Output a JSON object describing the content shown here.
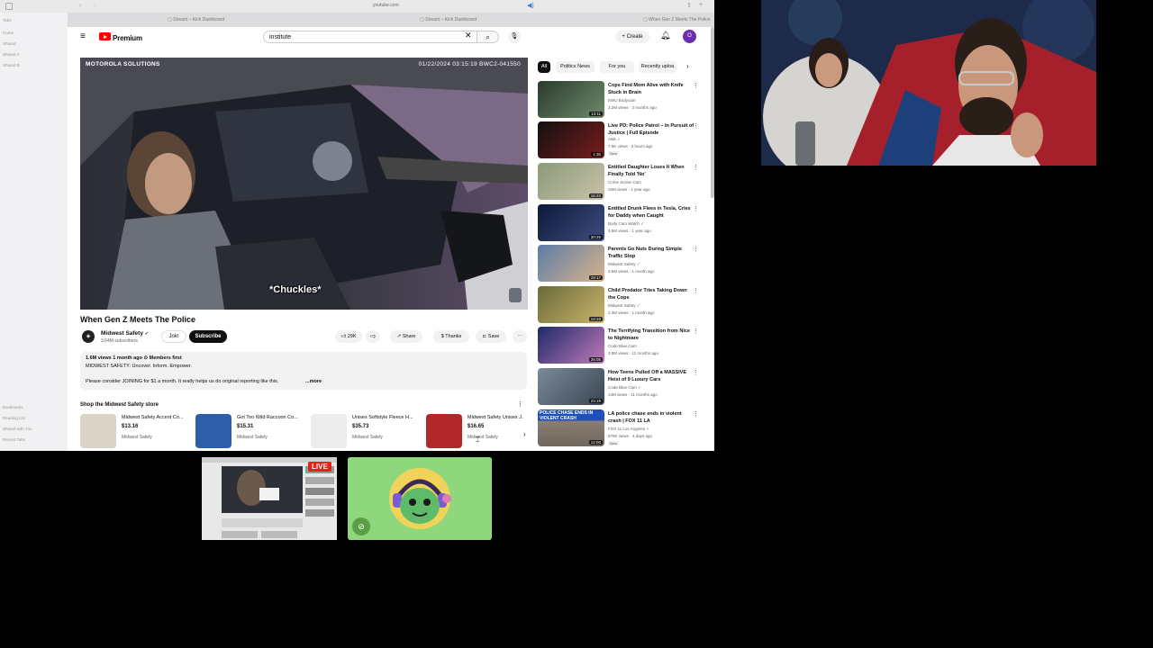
{
  "browser": {
    "url": "youtube.com",
    "tabs": [
      "Stream – Kick Dashboard",
      "Stream – Kick Dashboard",
      "When Gen Z Meets The Police"
    ],
    "sidebar_items": [
      "Tabs",
      "Home",
      "Shared",
      "Shared A",
      "Shared B",
      "Bookmarks",
      "Reading List",
      "Shared with You",
      "Recent Tabs"
    ]
  },
  "youtube": {
    "logo": "Premium",
    "search_value": "institute",
    "create_label": "Create",
    "avatar_letter": "O",
    "video": {
      "brand_overlay": "MOTOROLA SOLUTIONS",
      "timestamp_overlay": "01/22/2024 03:15:19  BWC2-041550",
      "caption": "*Chuckles*",
      "title": "When Gen Z Meets The Police"
    },
    "channel": {
      "name": "Midwest Safety",
      "subs": "3.64M subscribers",
      "join_label": "Join",
      "subscribe_label": "Subscribe"
    },
    "actions": {
      "likes": "29K",
      "share": "Share",
      "thanks": "Thanks",
      "save": "Save"
    },
    "description": {
      "stats": "1.6M views  1 month ago  ⊙ Members first",
      "line1": "MIDWEST SAFETY: Uncover. Inform. Empower.",
      "line2": "Please consider JOINING for $1 a month. It really helps us do original reporting like this.",
      "more": "...more"
    },
    "store": {
      "title": "Shop the Midwest Safety store",
      "products": [
        {
          "name": "Midwest Safety Accent Co...",
          "price": "$13.16",
          "store": "Midwest Safety"
        },
        {
          "name": "Got Too Wild Raccoon Co...",
          "price": "$15.31",
          "store": "Midwest Safety"
        },
        {
          "name": "Unisex Softstyle Fleece H...",
          "price": "$35.73",
          "store": "Midwest Safety"
        },
        {
          "name": "Midwest Safety Unisex J...",
          "price": "$16.65",
          "store": "Midwest Safety"
        }
      ]
    },
    "chips": [
      "All",
      "Politics News",
      "For you",
      "Recently uploa"
    ],
    "recommendations": [
      {
        "title": "Cops Find Mom Alive with Knife Stuck in Brain",
        "channel": "EWU Bodycam",
        "meta": "3.2M views · 2 months ago",
        "duration": "13:11",
        "new": ""
      },
      {
        "title": "Live PD: Police Patrol – In Pursuit of Justice | Full Episode",
        "channel": "A&E ✓",
        "meta": "7.5K views · 3 hours ago",
        "duration": "1:36",
        "new": "New"
      },
      {
        "title": "Entitled Daughter Loses It When Finally Told 'No'",
        "channel": "Crime Scene Cam",
        "meta": "10M views · 1 year ago",
        "duration": "16:22",
        "new": ""
      },
      {
        "title": "Entitled Drunk Flees in Tesla, Cries for Daddy when Caught",
        "channel": "Body Cam Watch ✓",
        "meta": "3.5M views · 1 year ago",
        "duration": "20:25",
        "new": ""
      },
      {
        "title": "Parents Go Nuts During Simple Traffic Stop",
        "channel": "Midwest Safety ✓",
        "meta": "3.6M views · 1 month ago",
        "duration": "19:17",
        "new": ""
      },
      {
        "title": "Child Predator Tries Taking Down the Cops",
        "channel": "Midwest Safety ✓",
        "meta": "2.3M views · 1 month ago",
        "duration": "14:10",
        "new": ""
      },
      {
        "title": "The Terrifying Transition from Nice to Nightmare",
        "channel": "Code Blue Cam",
        "meta": "3.9M views · 11 months ago",
        "duration": "26:05",
        "new": ""
      },
      {
        "title": "How Teens Pulled Off a MASSIVE Heist of 9 Luxury Cars",
        "channel": "Code Blue Cam ✓",
        "meta": "14M views · 11 months ago",
        "duration": "23:19",
        "new": ""
      },
      {
        "title": "LA police chase ends in violent crash | FOX 11 LA",
        "channel": "FOX 11 Los Angeles ✓",
        "meta": "879K views · 4 days ago",
        "duration": "12:00",
        "new": "New",
        "thumb_text": "POLICE CHASE ENDS IN VIOLENT CRASH"
      }
    ]
  },
  "overlay": {
    "live_badge": "LIVE"
  },
  "colors": {
    "youtube_red": "#ff0000",
    "live_red": "#e62117",
    "avatar_tile_green": "#8fd77d"
  }
}
